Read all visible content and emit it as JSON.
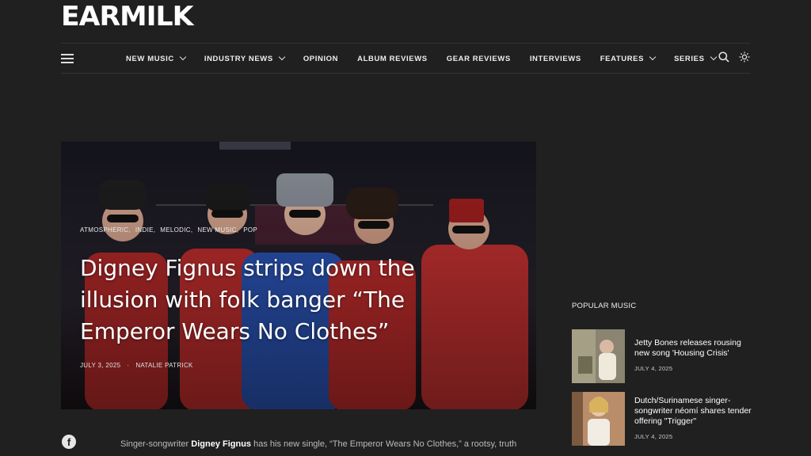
{
  "site": {
    "logo": "EARMILK"
  },
  "nav": {
    "items": [
      {
        "label": "NEW MUSIC",
        "dropdown": true
      },
      {
        "label": "INDUSTRY NEWS",
        "dropdown": true
      },
      {
        "label": "OPINION",
        "dropdown": false
      },
      {
        "label": "ALBUM REVIEWS",
        "dropdown": false
      },
      {
        "label": "GEAR REVIEWS",
        "dropdown": false
      },
      {
        "label": "INTERVIEWS",
        "dropdown": false
      },
      {
        "label": "FEATURES",
        "dropdown": true
      },
      {
        "label": "SERIES",
        "dropdown": true
      }
    ],
    "icons": [
      "menu-icon",
      "search-icon",
      "theme-toggle-icon"
    ]
  },
  "hero": {
    "categories": [
      "ATMOSPHERIC,",
      "INDIE,",
      "MELODIC,",
      "NEW MUSIC,",
      "POP"
    ],
    "title": "Digney Fignus strips down the illusion with folk banger “The Emperor Wears No Clothes”",
    "date": "JULY 3, 2025",
    "separator": "·",
    "author": "NATALIE PATRICK"
  },
  "popular": {
    "heading": "POPULAR MUSIC",
    "items": [
      {
        "title": "Jetty Bones releases rousing new song 'Housing Crisis'",
        "date": "JULY 4, 2025"
      },
      {
        "title": "Dutch/Surinamese singer-songwriter néomí shares tender offering \"Trigger\"",
        "date": "JULY 4, 2025"
      }
    ]
  },
  "article": {
    "intro_prefix": "Singer-songwriter ",
    "intro_bold": "Digney Fignus",
    "intro_suffix": " has his new single, “The Emperor Wears No Clothes,” a rootsy, truth"
  },
  "share": {
    "icon": "facebook-icon",
    "glyph": "f"
  },
  "colors": {
    "background": "#202020",
    "text": "#ffffff",
    "divider": "#333333"
  }
}
